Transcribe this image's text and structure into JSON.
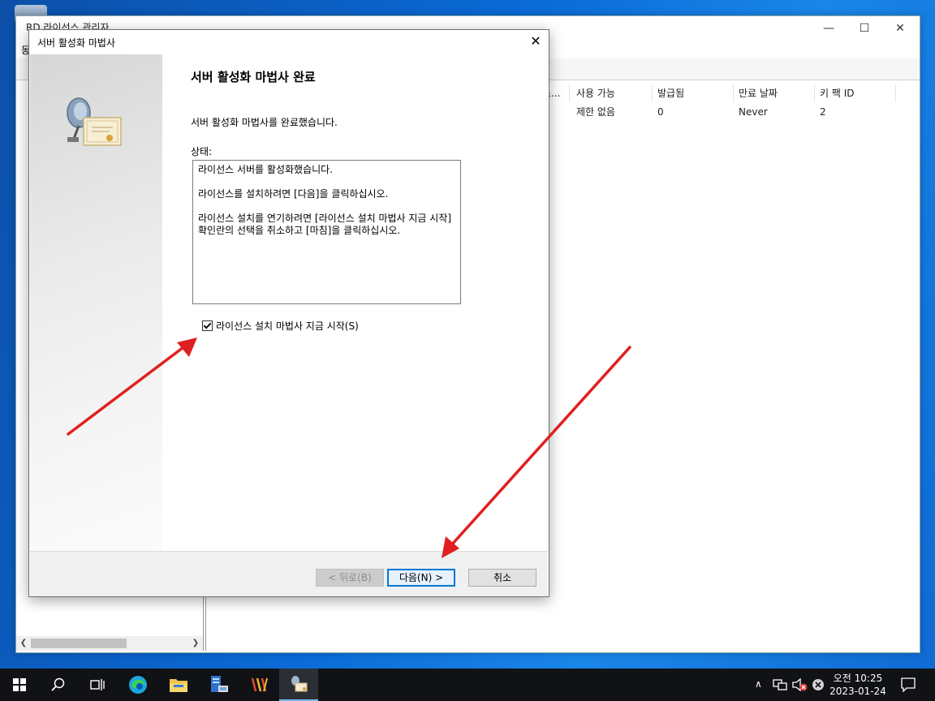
{
  "background_window": {
    "title": "RD 라이선스 관리자",
    "menu_fragment": "동",
    "columns": [
      "스...",
      "사용 가능",
      "발급됨",
      "만료 날짜",
      "키 팩 ID"
    ],
    "row": [
      "",
      "제한 없음",
      "0",
      "Never",
      "2"
    ]
  },
  "dialog": {
    "title": "서버 활성화 마법사",
    "heading": "서버 활성화 마법사 완료",
    "description": "서버 활성화 마법사를 완료했습니다.",
    "status_label": "상태:",
    "status_lines": [
      "라이선스 서버를 활성화했습니다.",
      "라이선스를 설치하려면 [다음]을 클릭하십시오.",
      "라이선스 설치를 연기하려면 [라이선스 설치 마법사 지금 시작] 확인란의 선택을 취소하고 [마침]을 클릭하십시오."
    ],
    "checkbox_label": "라이선스 설치 마법사 지금 시작(S)",
    "checkbox_checked": true,
    "buttons": {
      "back": "< 뒤로(B)",
      "next": "다음(N) >",
      "cancel": "취소"
    }
  },
  "annotation_color": "#e02020",
  "taskbar": {
    "icons": [
      "windows-start-icon",
      "search-icon",
      "task-view-icon",
      "edge-icon",
      "file-explorer-icon",
      "server-manager-icon",
      "app-icon",
      "rd-license-manager-icon"
    ],
    "time": "오전 10:25",
    "date": "2023-01-24"
  }
}
